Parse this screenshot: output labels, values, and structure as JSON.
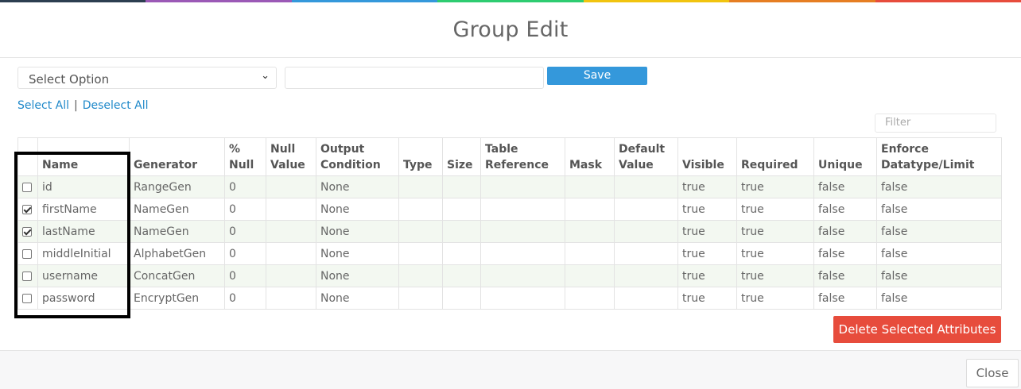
{
  "colors": {
    "stripe": [
      "#2c3e50",
      "#9b59b6",
      "#3498db",
      "#2ecc71",
      "#f1c40f",
      "#e67e22",
      "#e74c3c"
    ],
    "primary": "#3498db",
    "danger": "#e74c3c",
    "link": "#1e88c9"
  },
  "modal": {
    "title": "Group Edit"
  },
  "toolbar": {
    "select_label": "Select Option",
    "text_value": "",
    "save_label": "Save",
    "select_all": "Select All",
    "separator": "|",
    "deselect_all": "Deselect All",
    "filter_placeholder": "Filter"
  },
  "table": {
    "headers": [
      "",
      "Name",
      "Generator",
      "% Null",
      "Null Value",
      "Output Condition",
      "Type",
      "Size",
      "Table Reference",
      "Mask",
      "Default Value",
      "Visible",
      "Required",
      "Unique",
      "Enforce Datatype/Limit"
    ],
    "rows": [
      {
        "checked": false,
        "name": "id",
        "generator": "RangeGen",
        "null_pct": "0",
        "null_value": "",
        "output_condition": "None",
        "type": "",
        "size": "",
        "table_reference": "",
        "mask": "",
        "default_value": "",
        "visible": "true",
        "required": "true",
        "unique": "false",
        "enforce": "false"
      },
      {
        "checked": true,
        "name": "firstName",
        "generator": "NameGen",
        "null_pct": "0",
        "null_value": "",
        "output_condition": "None",
        "type": "",
        "size": "",
        "table_reference": "",
        "mask": "",
        "default_value": "",
        "visible": "true",
        "required": "true",
        "unique": "false",
        "enforce": "false"
      },
      {
        "checked": true,
        "name": "lastName",
        "generator": "NameGen",
        "null_pct": "0",
        "null_value": "",
        "output_condition": "None",
        "type": "",
        "size": "",
        "table_reference": "",
        "mask": "",
        "default_value": "",
        "visible": "true",
        "required": "true",
        "unique": "false",
        "enforce": "false"
      },
      {
        "checked": false,
        "name": "middleInitial",
        "generator": "AlphabetGen",
        "null_pct": "0",
        "null_value": "",
        "output_condition": "None",
        "type": "",
        "size": "",
        "table_reference": "",
        "mask": "",
        "default_value": "",
        "visible": "true",
        "required": "true",
        "unique": "false",
        "enforce": "false"
      },
      {
        "checked": false,
        "name": "username",
        "generator": "ConcatGen",
        "null_pct": "0",
        "null_value": "",
        "output_condition": "None",
        "type": "",
        "size": "",
        "table_reference": "",
        "mask": "",
        "default_value": "",
        "visible": "true",
        "required": "true",
        "unique": "false",
        "enforce": "false"
      },
      {
        "checked": false,
        "name": "password",
        "generator": "EncryptGen",
        "null_pct": "0",
        "null_value": "",
        "output_condition": "None",
        "type": "",
        "size": "",
        "table_reference": "",
        "mask": "",
        "default_value": "",
        "visible": "true",
        "required": "true",
        "unique": "false",
        "enforce": "false"
      }
    ]
  },
  "actions": {
    "delete_label": "Delete Selected Attributes",
    "close_label": "Close"
  }
}
